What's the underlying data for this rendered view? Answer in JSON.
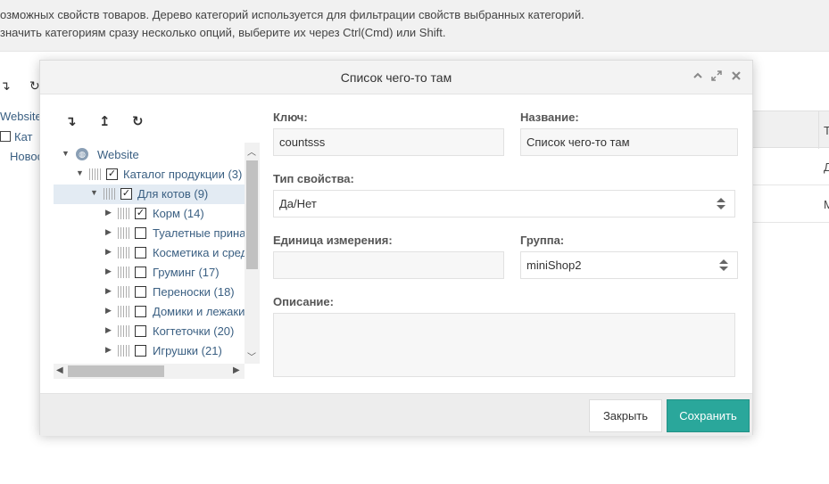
{
  "background": {
    "info_line1": "озможных свойств товаров. Дерево категорий используется для фильтрации свойств выбранных категорий.",
    "info_line2": "значить категориям сразу несколько опций, выберите их через Ctrl(Cmd) или Shift.",
    "tree": [
      "Website",
      "Кат",
      "Новос"
    ],
    "grid_header": "Т",
    "grid_rows": [
      "Д",
      "М"
    ]
  },
  "modal": {
    "title": "Список чего-то там",
    "tree": {
      "nodes": [
        {
          "label": "Website",
          "level": 0,
          "type": "root"
        },
        {
          "label": "Каталог продукции (3)",
          "level": 1,
          "checked": true,
          "expanded": true
        },
        {
          "label": "Для котов (9)",
          "level": 2,
          "checked": true,
          "expanded": true,
          "selected": true
        },
        {
          "label": "Корм (14)",
          "level": 3,
          "checked": true
        },
        {
          "label": "Туалетные принадлежности",
          "level": 3,
          "checked": false
        },
        {
          "label": "Косметика и средства",
          "level": 3,
          "checked": false
        },
        {
          "label": "Груминг (17)",
          "level": 3,
          "checked": false
        },
        {
          "label": "Переноски (18)",
          "level": 3,
          "checked": false
        },
        {
          "label": "Домики и лежаки",
          "level": 3,
          "checked": false
        },
        {
          "label": "Когтеточки (20)",
          "level": 3,
          "checked": false
        },
        {
          "label": "Игрушки (21)",
          "level": 3,
          "checked": false
        }
      ]
    },
    "form": {
      "key_label": "Ключ:",
      "key_value": "countsss",
      "name_label": "Название:",
      "name_value": "Список чего-то там",
      "type_label": "Тип свойства:",
      "type_value": "Да/Нет",
      "unit_label": "Единица измерения:",
      "unit_value": "",
      "group_label": "Группа:",
      "group_value": "miniShop2",
      "description_label": "Описание:",
      "description_value": ""
    },
    "buttons": {
      "close": "Закрыть",
      "save": "Сохранить"
    }
  },
  "colors": {
    "accent": "#2aa79b",
    "link": "#3a5f82",
    "selected_row": "#e3ebf3"
  }
}
